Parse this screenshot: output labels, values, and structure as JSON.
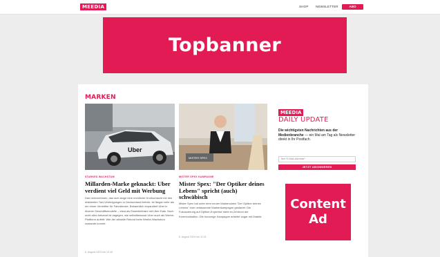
{
  "header": {
    "logo": "MEEDIA",
    "nav": [
      "SHOP",
      "NEWSLETTER"
    ],
    "cta": "ABO"
  },
  "topbanner": {
    "label": "Topbanner"
  },
  "section": {
    "title": "MARKEN"
  },
  "articles": [
    {
      "tag": "STARKES WACHSTUM",
      "headline": "Millarden-Marke geknackt: Uber verdient viel Geld mit Werbung",
      "body": "Das Unternehmen, das sich lange eine rechtliche Großschlacht mit den etablierten Taxi-Vereinigungen in Deutschland lieferte, ist längst mehr als ein reiner Vermittler für Fahrdienste. Bekanntlich expandiert Uber in diverse Geschäftsmodelle – etwa als Essenlieferant mit Uber Eats. Noch nicht allzu bekannt ist dagegen, wie selbstbewusst Uber auch als Werbe-Plattform auftritt. Wie der aktuelle Rekord beim Werbe-Wachstum zustande kommt.",
      "date": "6. August 2024 um 12:16",
      "image_brand": "Uber"
    },
    {
      "tag": "MISTER SPEX KAMPAGNE",
      "headline": "Mister Spex: \"Der Optiker deines Lebens\" spricht (auch) schwäbisch",
      "body": "Mister Spex hat unter dem neuen Markenclaim \"Der Optiker deines Lebens\" eine umfassende Markenkampagne gestartet. Die Fokussierung auf Optiker-Expertise steht im Zentrum der Kommunikation. Die humorige Kampagne arbeitet sogar mit Dialekt.",
      "date": "6. August 2024 um 11:01",
      "image_brand": "MISTER SPEX"
    }
  ],
  "newsletter": {
    "logo": "MEEDIA",
    "title": "DAILY UPDATE",
    "desc_bold": "Die wichtigsten Nachrichten aus der Medienbranche",
    "desc_rest": " — ein Mal am Tag als Newsletter direkt in Ihr Postfach.",
    "placeholder": "Ihre E-Mail-Adresse*",
    "button": "JETZT ABONNIEREN"
  },
  "content_ad": {
    "line1": "Content",
    "line2": "Ad"
  },
  "colors": {
    "accent": "#e31b54",
    "background": "#ededed",
    "card": "#ffffff"
  }
}
